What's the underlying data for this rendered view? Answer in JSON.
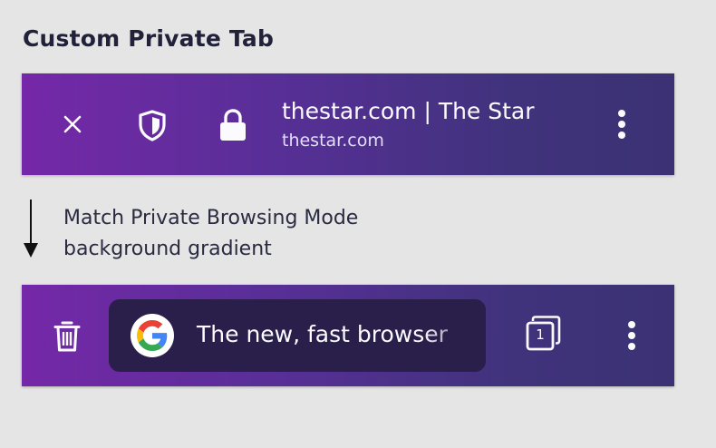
{
  "page": {
    "title": "Custom Private Tab"
  },
  "custom_tab_toolbar": {
    "close_icon": "close-icon",
    "tracking_protection_icon": "shield-icon",
    "security_icon": "lock-icon",
    "url_title": "thestar.com | The Star",
    "url_domain": "thestar.com",
    "menu_icon": "kebab-menu-icon"
  },
  "annotation": {
    "line1": "Match Private Browsing Mode",
    "line2": "background gradient"
  },
  "private_toolbar": {
    "delete_icon": "trash-icon",
    "search_engine_icon": "google-icon",
    "search_text": "The new, fast browser",
    "tab_count": "1",
    "menu_icon": "kebab-menu-icon"
  },
  "colors": {
    "gradient_start": "#7528a8",
    "gradient_end": "#3b3173",
    "search_bg": "#2a1e4b",
    "page_bg": "#e5e5e5"
  }
}
